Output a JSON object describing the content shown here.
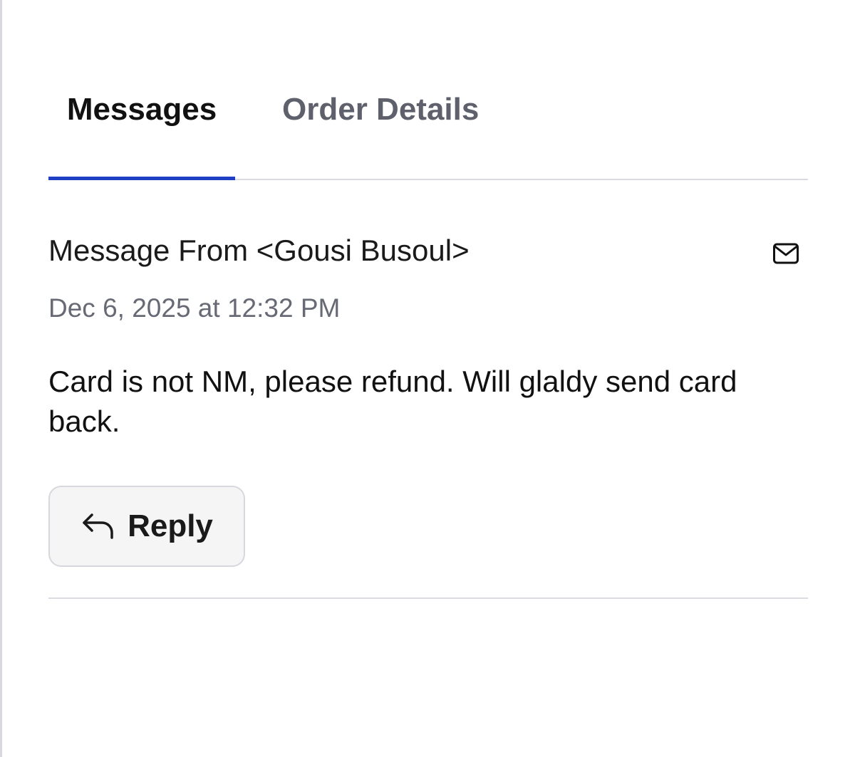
{
  "tabs": [
    {
      "label": "Messages",
      "active": true
    },
    {
      "label": "Order Details",
      "active": false
    }
  ],
  "message": {
    "from": "Message From <Gousi Busoul>",
    "date": "Dec 6, 2025 at 12:32 PM",
    "body": "Card is not NM, please refund. Will glaldy send card back."
  },
  "actions": {
    "reply_label": "Reply"
  },
  "icons": {
    "mail": "envelope-icon",
    "reply": "reply-arrow-icon"
  },
  "colors": {
    "accent": "#1f3fc4",
    "tab_inactive": "#5e616b",
    "muted_text": "#676a74",
    "button_bg": "#f5f5f6"
  }
}
